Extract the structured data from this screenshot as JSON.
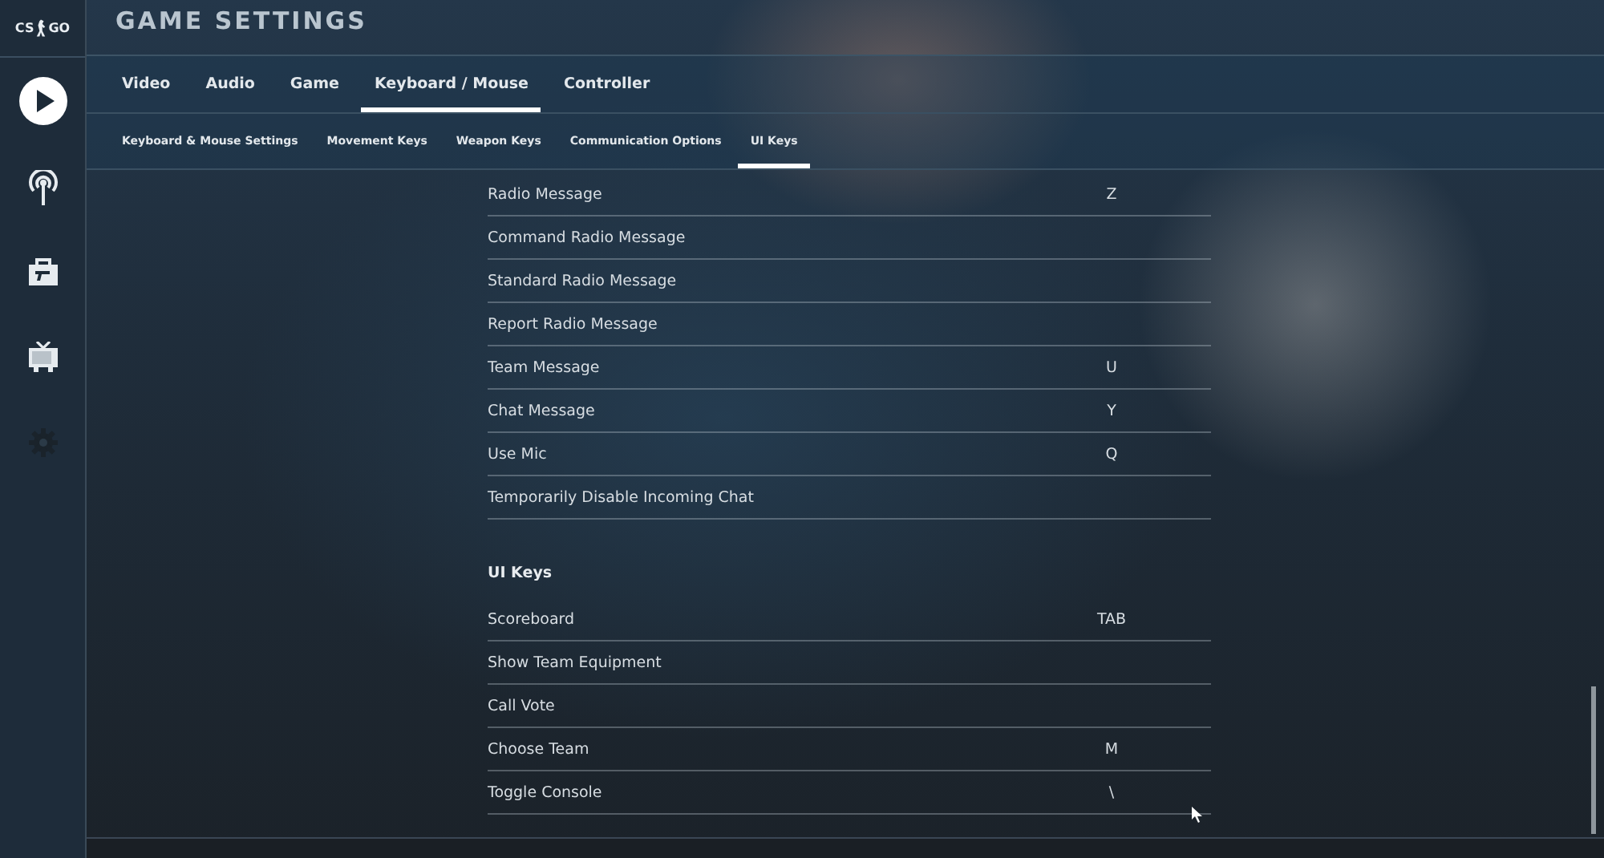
{
  "logo": {
    "left": "CS",
    "right": "GO"
  },
  "title": "GAME SETTINGS",
  "sidebar": {
    "items": [
      {
        "kind": "play",
        "selected": true
      },
      {
        "kind": "antenna",
        "selected": false
      },
      {
        "kind": "briefcase",
        "selected": false
      },
      {
        "kind": "tv",
        "selected": false
      },
      {
        "kind": "gear",
        "selected": false
      }
    ]
  },
  "tabs": [
    {
      "label": "Video",
      "selected": false
    },
    {
      "label": "Audio",
      "selected": false
    },
    {
      "label": "Game",
      "selected": false
    },
    {
      "label": "Keyboard / Mouse",
      "selected": true
    },
    {
      "label": "Controller",
      "selected": false
    }
  ],
  "subtabs": [
    {
      "label": "Keyboard & Mouse Settings",
      "selected": false
    },
    {
      "label": "Movement Keys",
      "selected": false
    },
    {
      "label": "Weapon Keys",
      "selected": false
    },
    {
      "label": "Communication Options",
      "selected": false
    },
    {
      "label": "UI Keys",
      "selected": true
    }
  ],
  "rows": [
    {
      "kind": "binding",
      "action": "Radio Message",
      "key": "Z"
    },
    {
      "kind": "binding",
      "action": "Command Radio Message"
    },
    {
      "kind": "binding",
      "action": "Standard Radio Message"
    },
    {
      "kind": "binding",
      "action": "Report Radio Message"
    },
    {
      "kind": "binding",
      "action": "Team Message",
      "key": "U"
    },
    {
      "kind": "binding",
      "action": "Chat Message",
      "key": "Y"
    },
    {
      "kind": "binding",
      "action": "Use Mic",
      "key": "Q"
    },
    {
      "kind": "binding",
      "action": "Temporarily Disable Incoming Chat"
    },
    {
      "kind": "header",
      "action": "UI Keys"
    },
    {
      "kind": "binding",
      "action": "Scoreboard",
      "key": "TAB"
    },
    {
      "kind": "binding",
      "action": "Show Team Equipment"
    },
    {
      "kind": "binding",
      "action": "Call Vote"
    },
    {
      "kind": "binding",
      "action": "Choose Team",
      "key": "M"
    },
    {
      "kind": "binding",
      "action": "Toggle Console",
      "key": "\\"
    }
  ]
}
